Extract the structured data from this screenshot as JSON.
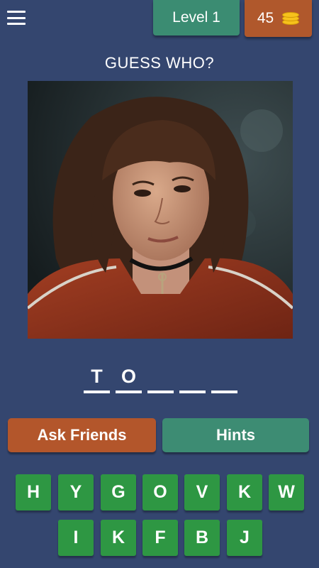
{
  "header": {
    "menu_icon": "hamburger-menu-icon",
    "level_label": "Level 1",
    "coins": "45",
    "coin_icon": "coin-stack-icon"
  },
  "title": "GUESS WHO?",
  "answer": {
    "slots": [
      "T",
      "O",
      "",
      "",
      ""
    ]
  },
  "actions": {
    "ask_friends_label": "Ask Friends",
    "hints_label": "Hints"
  },
  "keyboard": {
    "row1": [
      "H",
      "Y",
      "G",
      "O",
      "V",
      "K",
      "W"
    ],
    "row2": [
      "I",
      "K",
      "F",
      "B",
      "J"
    ]
  },
  "colors": {
    "background": "#34466f",
    "level_badge": "#3b8c72",
    "coins_badge": "#b0582c",
    "ask_button": "#b3562b",
    "hints_button": "#3d8c73",
    "key": "#2e9743"
  }
}
